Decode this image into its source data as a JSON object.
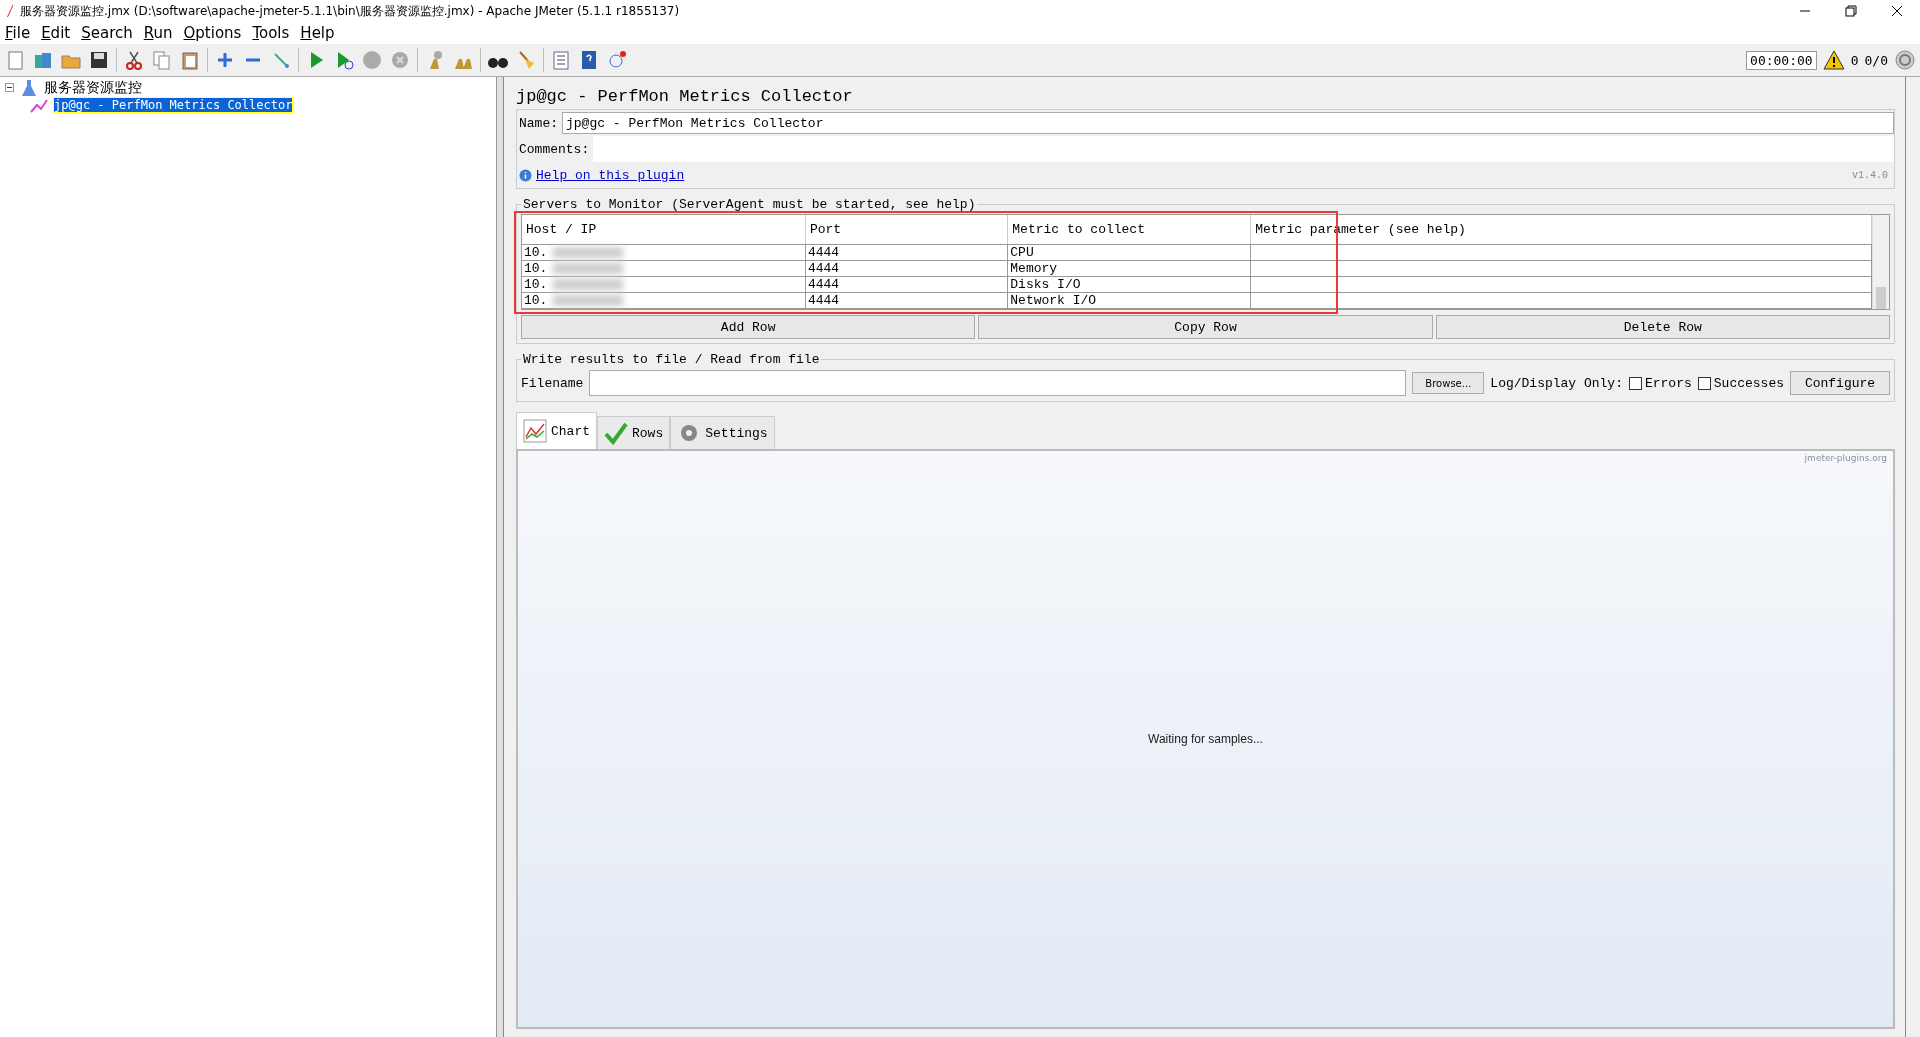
{
  "window": {
    "title": "服务器资源监控.jmx (D:\\software\\apache-jmeter-5.1.1\\bin\\服务器资源监控.jmx) - Apache JMeter (5.1.1 r1855137)"
  },
  "menu": [
    "File",
    "Edit",
    "Search",
    "Run",
    "Options",
    "Tools",
    "Help"
  ],
  "status": {
    "timer": "00:00:00",
    "warnings": "0",
    "threads": "0/0"
  },
  "tree": [
    {
      "label": "服务器资源监控",
      "expanded": true,
      "selected": false,
      "children": [
        {
          "label": "jp@gc - PerfMon Metrics Collector",
          "selected": true
        }
      ]
    }
  ],
  "panel": {
    "title": "jp@gc - PerfMon Metrics Collector",
    "name_label": "Name:",
    "name_value": "jp@gc - PerfMon Metrics Collector",
    "comments_label": "Comments:",
    "help_link": "Help on this plugin",
    "version": "v1.4.0"
  },
  "servers": {
    "legend": "Servers to Monitor (ServerAgent must be started, see help)",
    "columns": [
      "Host / IP",
      "Port",
      "Metric to collect",
      "Metric parameter (see help)"
    ],
    "rows": [
      {
        "cells": [
          "10.",
          "4444",
          "CPU"
        ]
      },
      {
        "cells": [
          "10.",
          "4444",
          "Memory"
        ]
      },
      {
        "cells": [
          "10.",
          "4444",
          "Disks I/O"
        ]
      },
      {
        "cells": [
          "10.",
          "4444",
          "Network I/O"
        ]
      }
    ],
    "buttons": [
      "Add Row",
      "Copy Row",
      "Delete Row"
    ]
  },
  "file": {
    "legend": "Write results to file / Read from file",
    "filename_label": "Filename",
    "browse": "Browse...",
    "log_label": "Log/Display Only:",
    "options": [
      {
        "label": "Errors",
        "checked": false
      },
      {
        "label": "Successes",
        "checked": false
      }
    ],
    "configure": "Configure"
  },
  "tabs": [
    {
      "label": "Chart",
      "kind": "chart",
      "selected": true
    },
    {
      "label": "Rows",
      "kind": "rows",
      "selected": false
    },
    {
      "label": "Settings",
      "kind": "settings",
      "selected": false
    }
  ],
  "chart": {
    "credit": "jmeter-plugins.org",
    "message": "Waiting for samples..."
  }
}
